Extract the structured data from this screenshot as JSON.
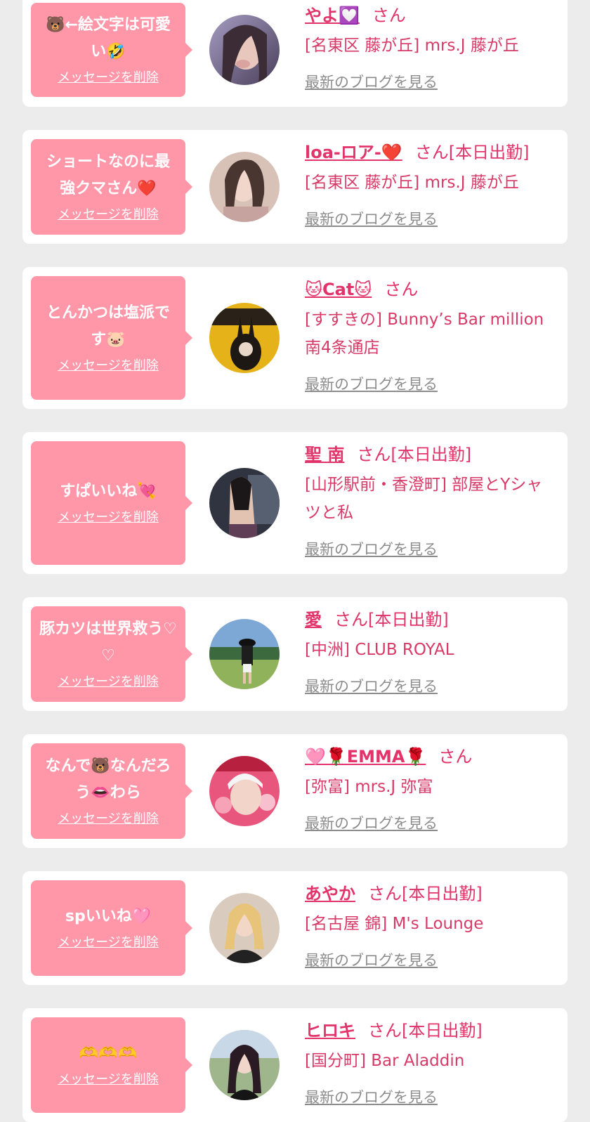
{
  "colors": {
    "page_background": "#ececec",
    "card_background": "#ffffff",
    "bubble_background": "#ff97a9",
    "bubble_text": "#ffffff",
    "name_text": "#e2336a",
    "shop_text": "#d83a68",
    "blog_link_text": "#8c8c8c"
  },
  "common": {
    "delete_label": "メッセージを削除",
    "blog_label": "最新のブログを見る"
  },
  "items": [
    {
      "message": "🐻←絵文字は可愛い🤣",
      "name": "やよ💟",
      "suffix": "さん",
      "shop": "[名東区 藤が丘] mrs.J 藤が丘",
      "avatar_icon": "portrait-photo"
    },
    {
      "message": "ショートなのに最強クマさん❤️",
      "name": "loa-ロア-❤️",
      "suffix": "さん[本日出勤]",
      "shop": "[名東区 藤が丘] mrs.J 藤が丘",
      "avatar_icon": "portrait-photo"
    },
    {
      "message": "とんかつは塩派です🐷",
      "name": "🐱Cat🐱",
      "suffix": "さん",
      "shop": "[すすきの] Bunny’s Bar million 南4条通店",
      "avatar_icon": "magazine-cover-photo"
    },
    {
      "message": "すぱいいね💘",
      "name": "聖 南",
      "suffix": "さん[本日出勤]",
      "shop": "[山形駅前・香澄町] 部屋とYシャツと私",
      "avatar_icon": "portrait-photo"
    },
    {
      "message": "豚カツは世界救う♡♡",
      "name": "愛",
      "suffix": "さん[本日出勤]",
      "shop": "[中洲] CLUB ROYAL",
      "avatar_icon": "outdoor-photo"
    },
    {
      "message": "なんで🐻なんだろう👄わら",
      "name": "🩷🌹EMMA🌹",
      "suffix": "さん",
      "shop": "[弥富] mrs.J 弥富",
      "avatar_icon": "portrait-photo"
    },
    {
      "message": "spいいね🩷",
      "name": "あやか",
      "suffix": "さん[本日出勤]",
      "shop": "[名古屋 錦] M's Lounge",
      "avatar_icon": "portrait-photo"
    },
    {
      "message": "🫶🫶🫶",
      "name": "ヒロキ",
      "suffix": "さん[本日出勤]",
      "shop": "[国分町] Bar Aladdin",
      "avatar_icon": "portrait-photo"
    }
  ]
}
